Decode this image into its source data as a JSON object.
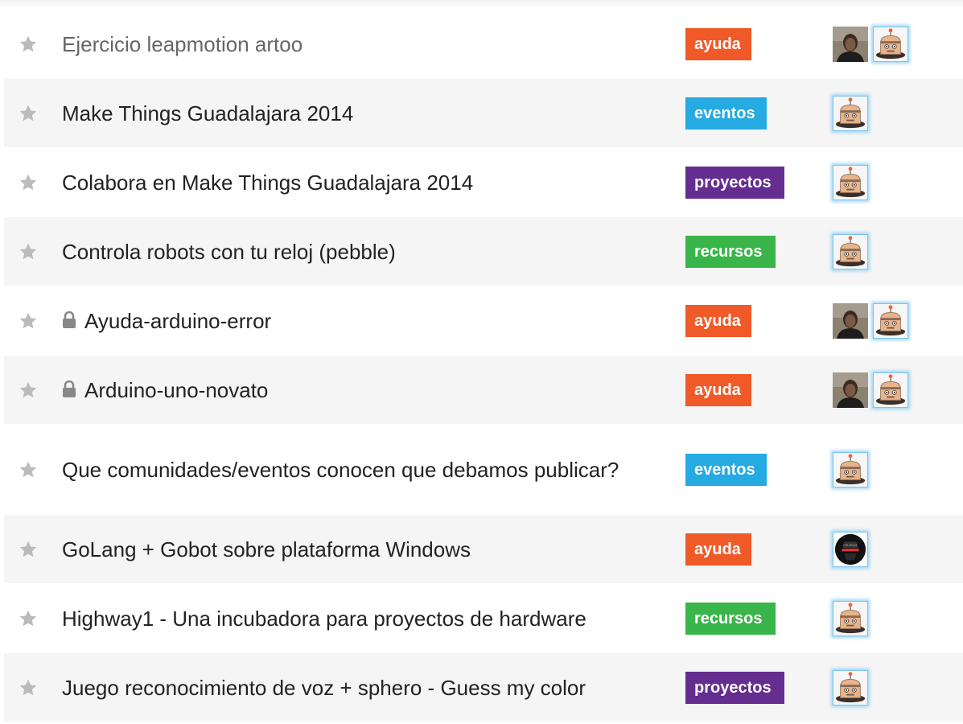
{
  "categories": {
    "ayuda": {
      "label": "ayuda",
      "color": "#f05a28"
    },
    "eventos": {
      "label": "eventos",
      "color": "#25aae1"
    },
    "proyectos": {
      "label": "proyectos",
      "color": "#652d90"
    },
    "recursos": {
      "label": "recursos",
      "color": "#3ab54a"
    }
  },
  "topics": [
    {
      "title": "Ejercicio leapmotion artoo",
      "visited": true,
      "locked": false,
      "category": "ayuda",
      "posters": [
        "photo-avatar",
        "robot-avatar"
      ]
    },
    {
      "title": "Make Things Guadalajara 2014",
      "visited": false,
      "locked": false,
      "category": "eventos",
      "posters": [
        "robot-avatar"
      ]
    },
    {
      "title": "Colabora en Make Things Guadalajara 2014",
      "visited": false,
      "locked": false,
      "category": "proyectos",
      "posters": [
        "robot-avatar"
      ]
    },
    {
      "title": "Controla robots con tu reloj (pebble)",
      "visited": false,
      "locked": false,
      "category": "recursos",
      "posters": [
        "robot-avatar"
      ]
    },
    {
      "title": "Ayuda-arduino-error",
      "visited": false,
      "locked": true,
      "category": "ayuda",
      "posters": [
        "photo-avatar",
        "robot-avatar"
      ]
    },
    {
      "title": "Arduino-uno-novato",
      "visited": false,
      "locked": true,
      "category": "ayuda",
      "posters": [
        "photo-avatar",
        "robot-avatar"
      ]
    },
    {
      "title": "Que comunidades/eventos conocen que debamos publicar?",
      "visited": false,
      "locked": false,
      "category": "eventos",
      "posters": [
        "robot-avatar"
      ]
    },
    {
      "title": "GoLang + Gobot sobre plataforma Windows",
      "visited": false,
      "locked": false,
      "category": "ayuda",
      "posters": [
        "cylon-avatar"
      ]
    },
    {
      "title": "Highway1 - Una incubadora para proyectos de hardware",
      "visited": false,
      "locked": false,
      "category": "recursos",
      "posters": [
        "robot-avatar"
      ]
    },
    {
      "title": "Juego reconocimiento de voz + sphero - Guess my color",
      "visited": false,
      "locked": false,
      "category": "proyectos",
      "posters": [
        "robot-avatar"
      ]
    }
  ],
  "icons": {
    "star": "star-icon",
    "lock": "lock-icon"
  }
}
